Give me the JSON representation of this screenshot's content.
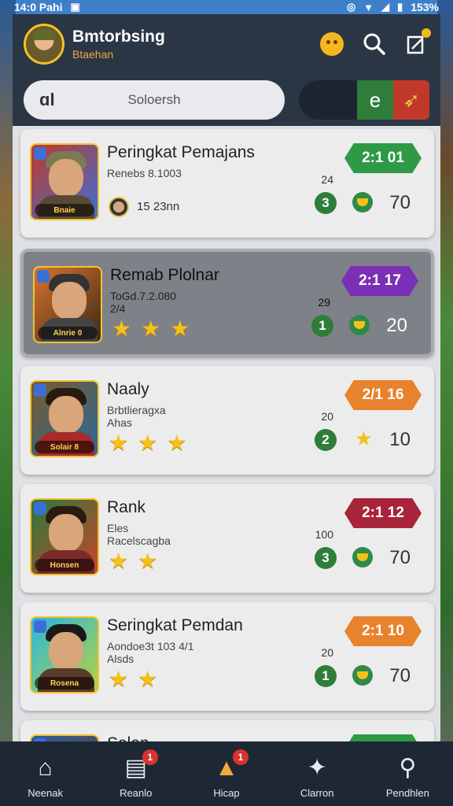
{
  "statusbar": {
    "time": "14:0 Pahi",
    "battery": "153%"
  },
  "header": {
    "title": "Bmtorbsing",
    "subtitle": "Btaehan"
  },
  "search": {
    "prefix": "ɑl",
    "placeholder": "Soloersh"
  },
  "toggle": {
    "green_glyph": "e"
  },
  "players": [
    {
      "name": "Peringkat Pemajans",
      "meta": "Renebs 8.1003",
      "thumb_label": "Bnaie",
      "rank": "2:1  01",
      "rank_color": "#2e9a45",
      "small": "24",
      "level": "3",
      "score": "70",
      "mini_text": "15 23nn",
      "stars": 0,
      "right_icon": "coin"
    },
    {
      "name": "Remab Plolnar",
      "meta": "ToGd.7.2.080\n2/4",
      "thumb_label": "Alnrie 0",
      "rank": "2:1  17",
      "rank_color": "#7b2fb5",
      "small": "29",
      "level": "1",
      "score": "20",
      "stars": 3,
      "right_icon": "coin"
    },
    {
      "name": "Naaly",
      "meta": "Brbtlieragxa\nAhas",
      "thumb_label": "Solair 8",
      "rank": "2/1  16",
      "rank_color": "#e8822d",
      "small": "20",
      "level": "2",
      "score": "10",
      "stars": 3,
      "right_icon": "star"
    },
    {
      "name": "Rank",
      "meta": "Eles\nRacelscagba",
      "thumb_label": "Honsen",
      "rank": "2:1  12",
      "rank_color": "#a8243a",
      "small": "100",
      "level": "3",
      "score": "70",
      "stars": 2,
      "right_icon": "coin"
    },
    {
      "name": "Seringkat Pemdan",
      "meta": "Aondoe3t 103 4/1\nAlsds",
      "thumb_label": "Rosena",
      "rank": "2:1  10",
      "rank_color": "#e8822d",
      "small": "20",
      "level": "1",
      "score": "70",
      "stars": 2,
      "right_icon": "coin"
    },
    {
      "name": "Solan",
      "meta": "",
      "thumb_label": "",
      "rank": "",
      "rank_color": "#2e9a45",
      "small": "",
      "level": "",
      "score": "",
      "stars": 0,
      "right_icon": "coin"
    }
  ],
  "nav": [
    {
      "label": "Neenak",
      "icon": "home-icon",
      "badge": ""
    },
    {
      "label": "Reanlo",
      "icon": "shop-icon",
      "badge": "1"
    },
    {
      "label": "Hicap",
      "icon": "rank-icon",
      "badge": "1"
    },
    {
      "label": "Clarron",
      "icon": "puzzle-icon",
      "badge": ""
    },
    {
      "label": "Pendhlen",
      "icon": "search-icon",
      "badge": ""
    }
  ]
}
